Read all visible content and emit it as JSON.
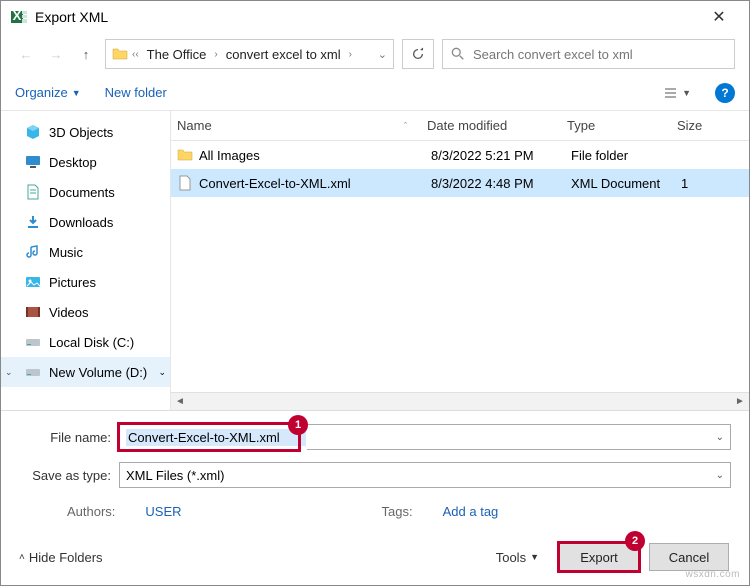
{
  "title": "Export XML",
  "breadcrumb": {
    "part1": "The Office",
    "part2": "convert excel to xml"
  },
  "search": {
    "placeholder": "Search convert excel to xml"
  },
  "toolbar": {
    "organize": "Organize",
    "newfolder": "New folder"
  },
  "sidebar": {
    "items": [
      {
        "label": "3D Objects"
      },
      {
        "label": "Desktop"
      },
      {
        "label": "Documents"
      },
      {
        "label": "Downloads"
      },
      {
        "label": "Music"
      },
      {
        "label": "Pictures"
      },
      {
        "label": "Videos"
      },
      {
        "label": "Local Disk (C:)"
      },
      {
        "label": "New Volume (D:)"
      }
    ]
  },
  "columns": {
    "name": "Name",
    "date": "Date modified",
    "type": "Type",
    "size": "Size"
  },
  "files": [
    {
      "name": "All Images",
      "date": "8/3/2022 5:21 PM",
      "type": "File folder",
      "size": ""
    },
    {
      "name": "Convert-Excel-to-XML.xml",
      "date": "8/3/2022 4:48 PM",
      "type": "XML Document",
      "size": "1"
    }
  ],
  "filename": {
    "label": "File name:",
    "value": "Convert-Excel-to-XML.xml"
  },
  "savetype": {
    "label": "Save as type:",
    "value": "XML Files (*.xml)"
  },
  "meta": {
    "authors_label": "Authors:",
    "authors_value": "USER",
    "tags_label": "Tags:",
    "tags_value": "Add a tag"
  },
  "buttons": {
    "hidefolders": "Hide Folders",
    "tools": "Tools",
    "export": "Export",
    "cancel": "Cancel"
  },
  "callouts": {
    "one": "1",
    "two": "2"
  },
  "watermark": "wsxdn.com"
}
